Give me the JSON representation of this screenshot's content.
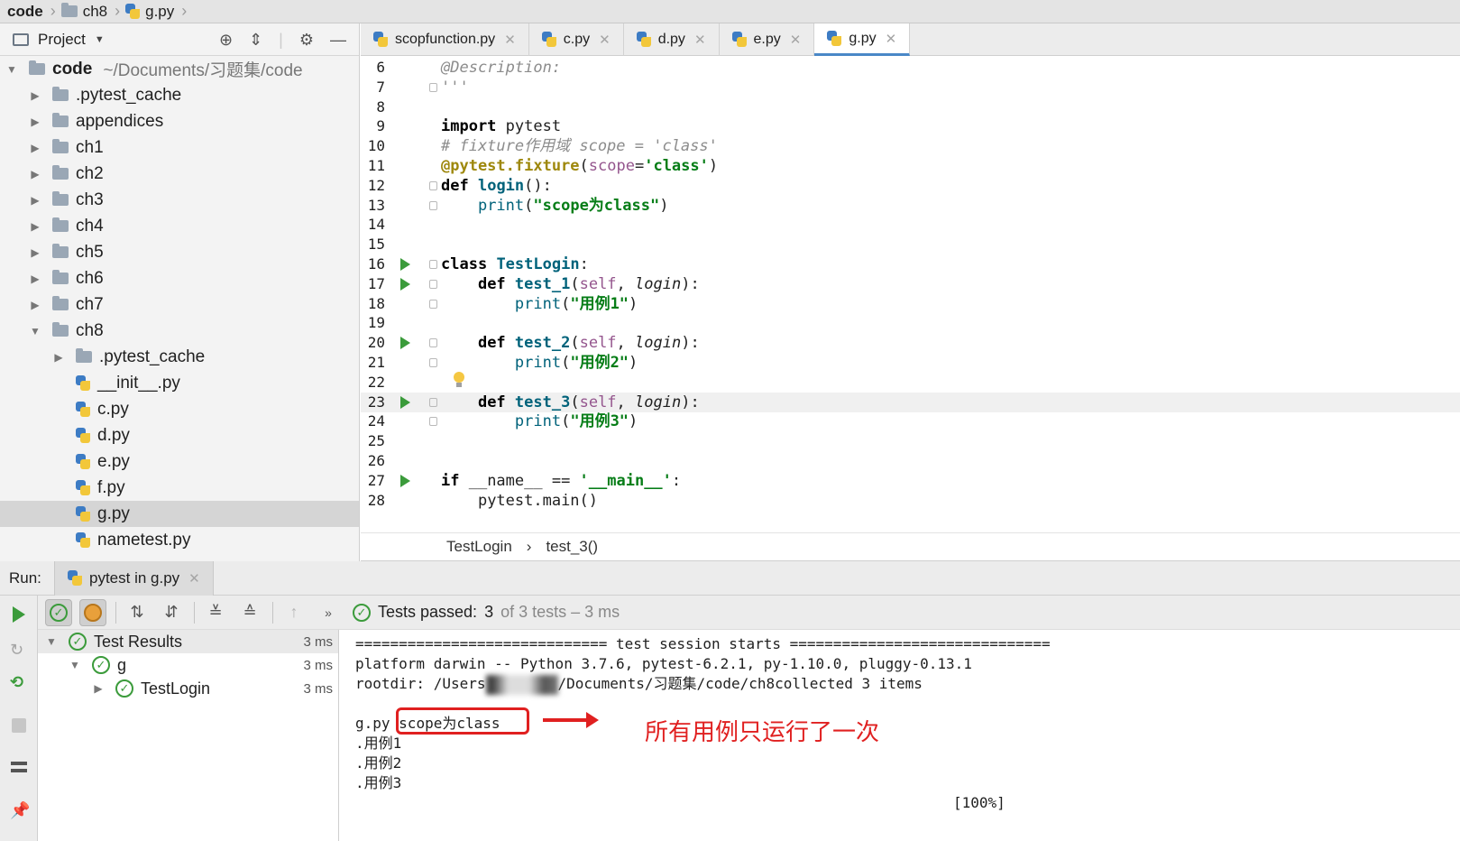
{
  "breadcrumb": [
    "code",
    "ch8",
    "g.py"
  ],
  "project": {
    "title": "Project",
    "root_name": "code",
    "root_path": "~/Documents/习题集/code",
    "folders_top": [
      ".pytest_cache",
      "appendices",
      "ch1",
      "ch2",
      "ch3",
      "ch4",
      "ch5",
      "ch6",
      "ch7"
    ],
    "open_folder": "ch8",
    "ch8_children": [
      ".pytest_cache",
      "__init__.py",
      "c.py",
      "d.py",
      "e.py",
      "f.py",
      "g.py",
      "nametest.py"
    ]
  },
  "tabs": [
    "scopfunction.py",
    "c.py",
    "d.py",
    "e.py",
    "g.py"
  ],
  "active_tab": "g.py",
  "editor": {
    "lines": [
      {
        "n": "6"
      },
      {
        "n": "7"
      },
      {
        "n": "8"
      },
      {
        "n": "9"
      },
      {
        "n": "10"
      },
      {
        "n": "11"
      },
      {
        "n": "12"
      },
      {
        "n": "13"
      },
      {
        "n": "14"
      },
      {
        "n": "15"
      },
      {
        "n": "16"
      },
      {
        "n": "17"
      },
      {
        "n": "18"
      },
      {
        "n": "19"
      },
      {
        "n": "20"
      },
      {
        "n": "21"
      },
      {
        "n": "22"
      },
      {
        "n": "23"
      },
      {
        "n": "24"
      },
      {
        "n": "25"
      },
      {
        "n": "26"
      },
      {
        "n": "27"
      },
      {
        "n": "28"
      }
    ],
    "text": {
      "l6": "@Description:",
      "l7": "'''",
      "l9_kw": "import",
      "l9_rest": " pytest",
      "l10": "# fixture作用域 scope = 'class'",
      "l11_dec": "@pytest.fixture",
      "l11_open": "(",
      "l11_param": "scope",
      "l11_eq": "=",
      "l11_str": "'class'",
      "l11_close": ")",
      "l12_kw": "def",
      "l12_fn": "login",
      "l12_rest": "():",
      "l13_fn": "print",
      "l13_str": "\"scope为class\"",
      "l16_kw": "class",
      "l16_name": "TestLogin",
      "l16_rest": ":",
      "l17_kw": "def",
      "l17_fn": "test_1",
      "l17_self": "self",
      "l17_param": "login",
      "l18_fn": "print",
      "l18_str": "\"用例1\"",
      "l20_kw": "def",
      "l20_fn": "test_2",
      "l20_self": "self",
      "l20_param": "login",
      "l21_fn": "print",
      "l21_str": "\"用例2\"",
      "l23_kw": "def",
      "l23_fn": "test_3",
      "l23_self": "self",
      "l23_param": "login",
      "l24_fn": "print",
      "l24_str": "\"用例3\"",
      "l27_kw": "if",
      "l27_mid": " __name__ == ",
      "l27_str": "'__main__'",
      "l27_rest": ":",
      "l28": "pytest.main()"
    }
  },
  "editor_crumb": [
    "TestLogin",
    "test_3()"
  ],
  "run": {
    "label": "Run:",
    "tab": "pytest in g.py",
    "status_prefix": "Tests passed:",
    "status_count": "3",
    "status_suffix": "of 3 tests – 3 ms"
  },
  "results": [
    {
      "label": "Test Results",
      "time": "3 ms"
    },
    {
      "label": "g",
      "time": "3 ms"
    },
    {
      "label": "TestLogin",
      "time": "3 ms"
    }
  ],
  "console": {
    "l1": "============================= test session starts ==============================",
    "l2": "platform darwin -- Python 3.7.6, pytest-6.2.1, py-1.10.0, pluggy-0.13.1",
    "l3a": "rootdir: /Users",
    "l3b": "/Documents/习题集/code/ch8collected 3 items",
    "l5a": "g.py ",
    "l5b": "scope为class",
    "l6": ".用例1",
    "l7": ".用例2",
    "l8": ".用例3",
    "l9": "[100%]",
    "annotation": "所有用例只运行了一次"
  },
  "colors": {
    "accent_green": "#3b9b3b",
    "annotation_red": "#e02020",
    "tab_underline": "#4a88c7"
  }
}
